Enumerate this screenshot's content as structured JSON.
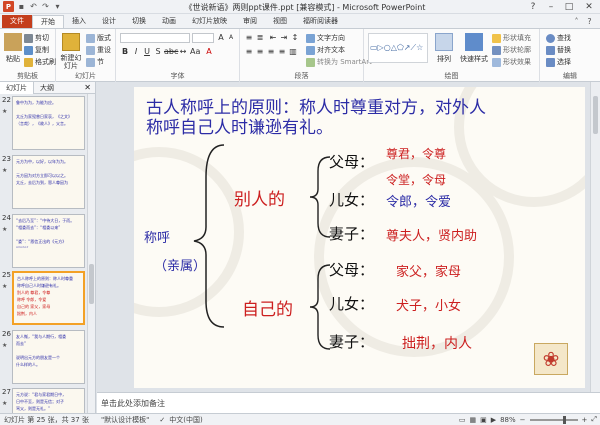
{
  "window": {
    "title": "《世说新语》两则ppt课件.ppt [兼容模式] - Microsoft PowerPoint"
  },
  "tabs": [
    "文件",
    "开始",
    "插入",
    "设计",
    "切换",
    "动画",
    "幻灯片放映",
    "审阅",
    "视图",
    "福昕阅读器"
  ],
  "ribbon": {
    "clipboard": {
      "label": "剪贴板",
      "paste": "粘贴",
      "cut": "剪切",
      "copy": "复制",
      "format_painter": "格式刷"
    },
    "slides": {
      "label": "幻灯片",
      "new_slide": "新建幻灯片",
      "layout": "版式",
      "reset": "重设",
      "section": "节"
    },
    "font": {
      "label": "字体",
      "font_name": "",
      "font_size": ""
    },
    "paragraph": {
      "label": "段落",
      "text_direction": "文字方向",
      "align_text": "对齐文本",
      "smartart": "转换为 SmartArt"
    },
    "drawing": {
      "label": "绘图",
      "arrange": "排列",
      "quick_styles": "快速样式",
      "shape_fill": "形状填充",
      "shape_outline": "形状轮廓",
      "shape_effects": "形状效果"
    },
    "editing": {
      "label": "编辑",
      "find": "查找",
      "replace": "替换",
      "select": "选择"
    }
  },
  "left_panel": {
    "tab_slides": "幻灯片",
    "tab_outline": "大纲",
    "thumbnails": [
      {
        "num": "22",
        "lines": [
          {
            "t": "鲁中为为，为能为应。",
            "c": "b"
          },
          {
            "t": "",
            "c": "b"
          },
          {
            "t": "太丘为家殁曾日家哀，《之文》",
            "c": "b"
          },
          {
            "t": "（言哉），《故人》，父言。",
            "c": "b"
          }
        ]
      },
      {
        "num": "23",
        "lines": [
          {
            "t": "元方为中，以好，以年为为。",
            "c": "b"
          },
          {
            "t": "",
            "c": "b"
          },
          {
            "t": "元方因为对方立即可以以之。",
            "c": "b"
          },
          {
            "t": "太丘，去后为到，恩人尊因为",
            "c": "b"
          }
        ]
      },
      {
        "num": "24",
        "lines": [
          {
            "t": "“去后乃至”：“中待大日，于而。",
            "c": "b"
          },
          {
            "t": "“相委而去”：“相委以来”",
            "c": "b"
          },
          {
            "t": "",
            "c": "b"
          },
          {
            "t": "“委”：“恩信正出的《元方》",
            "c": "b"
          },
          {
            "t": "“”“”“”",
            "c": "b"
          }
        ]
      },
      {
        "num": "25",
        "lines": [
          {
            "t": "古人称呼上的原则：称人时尊重",
            "c": "b"
          },
          {
            "t": "称呼自己人时谦逊有礼。",
            "c": "b"
          },
          {
            "t": "别人的  尊君，令尊",
            "c": "r"
          },
          {
            "t": "称呼  令郎，令爱",
            "c": "r"
          },
          {
            "t": "自己的  家父，家母",
            "c": "r"
          },
          {
            "t": "      拙荆，内人",
            "c": "r"
          }
        ]
      },
      {
        "num": "26",
        "lines": [
          {
            "t": "友人惭，“我与人期行，相委",
            "c": "b"
          },
          {
            "t": "而去”",
            "c": "b"
          },
          {
            "t": "",
            "c": "b"
          },
          {
            "t": "说明出元方的朋友是一个",
            "c": "b"
          },
          {
            "t": "什么样的人。",
            "c": "b"
          }
        ]
      },
      {
        "num": "27",
        "lines": [
          {
            "t": "元方说：“君与家君期日中，",
            "c": "b"
          },
          {
            "t": "日中不至，则是无信；对子",
            "c": "b"
          },
          {
            "t": "骂父，则是无礼。”",
            "c": "b"
          }
        ]
      }
    ]
  },
  "slide": {
    "heading_line1": "古人称呼上的原则：称人时尊重对方，对外人",
    "heading_line2": "称呼自己人时谦逊有礼。",
    "label_chengwu": "称呼",
    "label_qinshu": "（亲属）",
    "others_label": "别人的",
    "own_label": "自己的",
    "others": [
      {
        "role": "父母：",
        "terms_top": "尊君，令尊",
        "terms_bottom": "令堂，令母"
      },
      {
        "role": "儿女：",
        "terms": "令郎，令爱"
      },
      {
        "role": "妻子：",
        "terms": "尊夫人，贤内助"
      }
    ],
    "own": [
      {
        "role": "父母：",
        "terms": "家父，家母"
      },
      {
        "role": "儿女：",
        "terms": "犬子，小女"
      },
      {
        "role": "妻子：",
        "terms": "拙荆，内人"
      }
    ]
  },
  "notes": {
    "placeholder": "单击此处添加备注"
  },
  "status": {
    "slide_info": "幻灯片 第 25 张，共 37 张",
    "theme": "\"默认设计模板\"",
    "language": "中文(中国)",
    "zoom": "88%"
  },
  "colors": {
    "file_tab": "#c43e1c",
    "slide_blue": "#2c2ca6",
    "slide_red": "#cc1f1f",
    "selected_thumb": "#f3a126"
  }
}
